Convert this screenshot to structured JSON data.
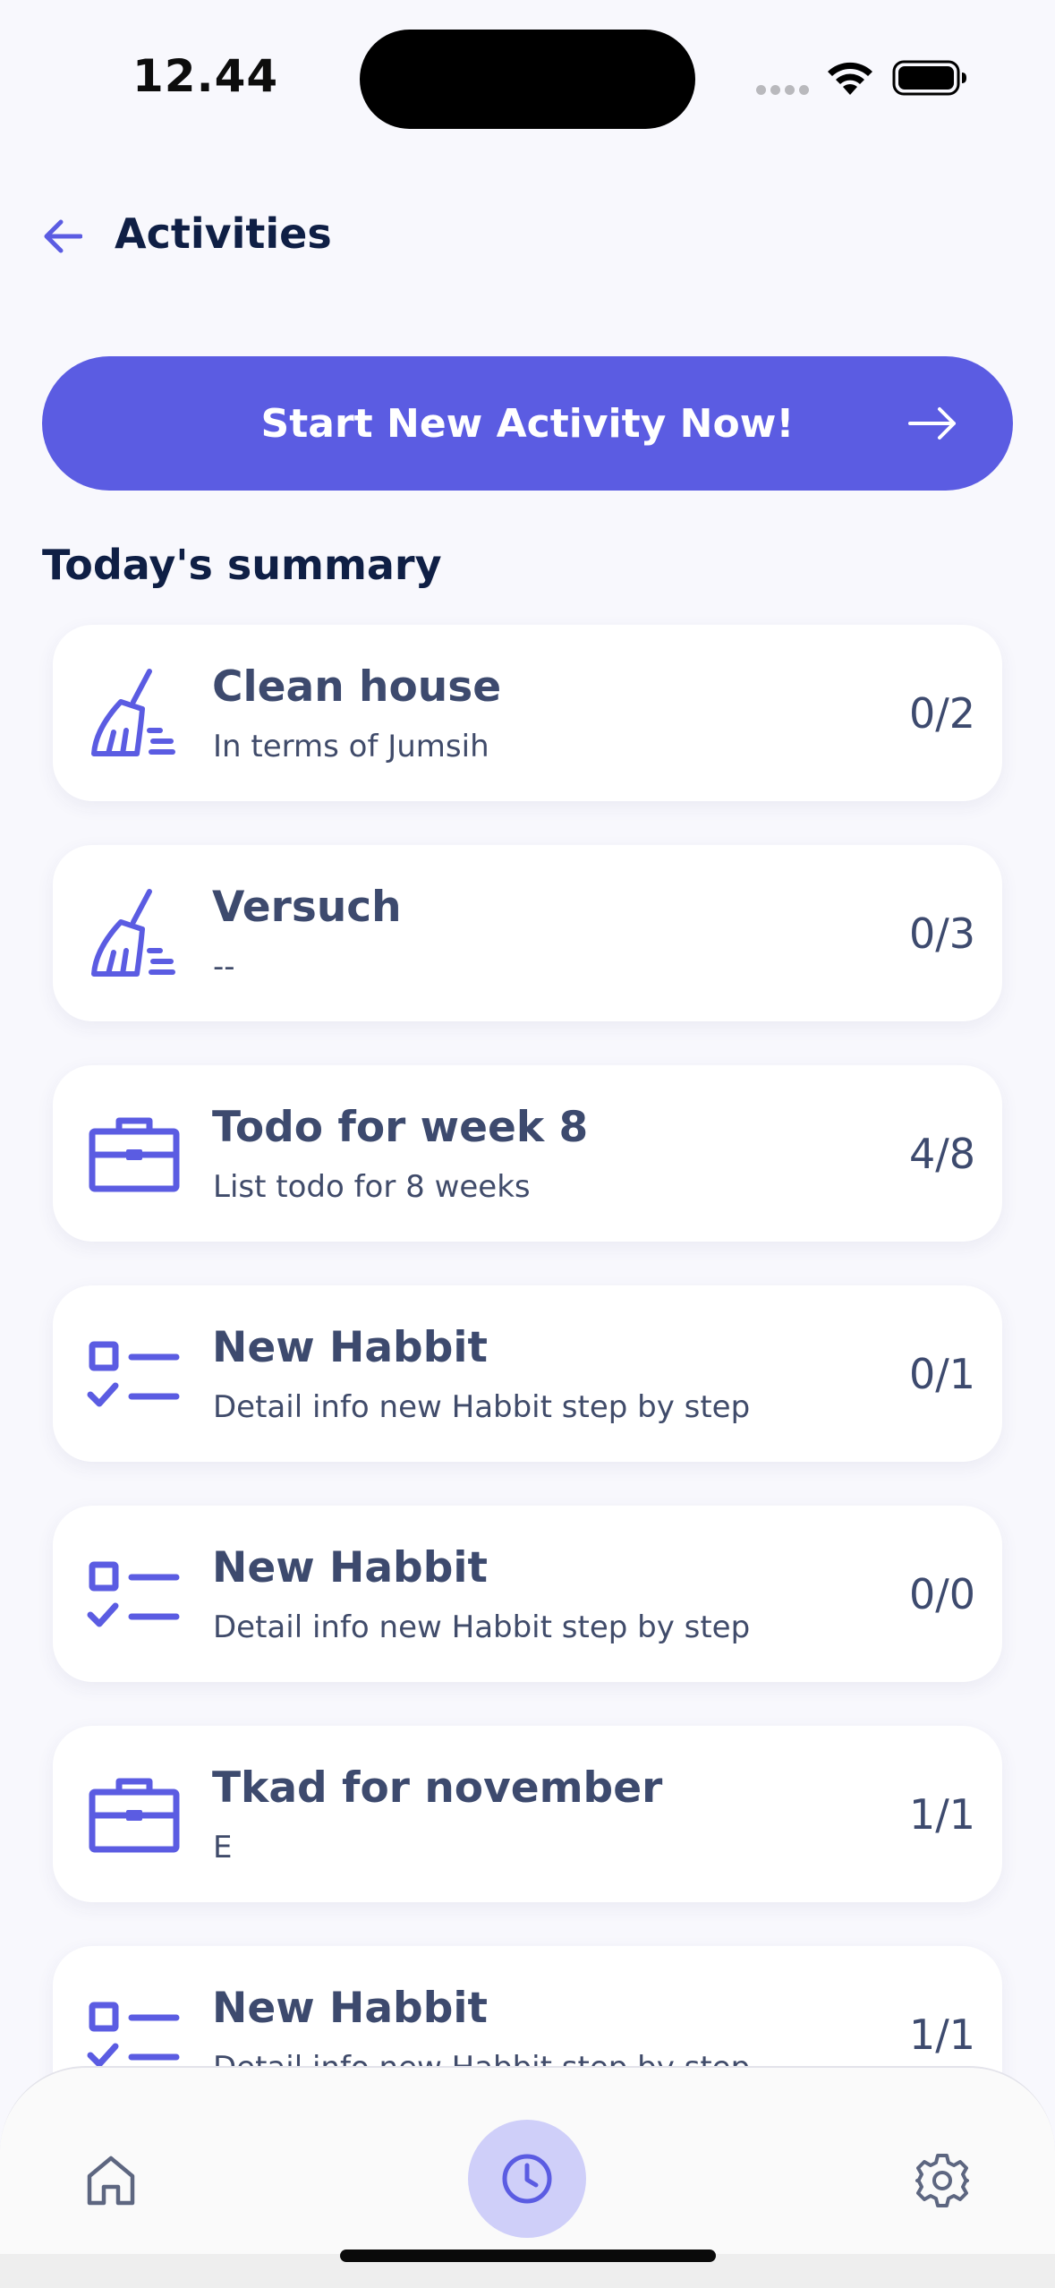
{
  "status_bar": {
    "time": "12.44"
  },
  "header": {
    "title": "Activities",
    "back_icon": "arrow-left-icon"
  },
  "cta": {
    "label": "Start New Activity Now!",
    "icon": "arrow-right-icon"
  },
  "summary": {
    "title": "Today's summary",
    "items": [
      {
        "title": "Clean house",
        "subtitle": "In terms of Jumsih",
        "count": "0/2",
        "icon": "broom-icon"
      },
      {
        "title": "Versuch",
        "subtitle": "--",
        "count": "0/3",
        "icon": "broom-icon"
      },
      {
        "title": "Todo for week 8",
        "subtitle": "List todo for 8 weeks",
        "count": "4/8",
        "icon": "briefcase-icon"
      },
      {
        "title": "New Habbit",
        "subtitle": "Detail info new Habbit step by step",
        "count": "0/1",
        "icon": "checklist-icon"
      },
      {
        "title": "New Habbit",
        "subtitle": "Detail info new Habbit step by step",
        "count": "0/0",
        "icon": "checklist-icon"
      },
      {
        "title": "Tkad for november",
        "subtitle": "E",
        "count": "1/1",
        "icon": "briefcase-icon"
      },
      {
        "title": "New Habbit",
        "subtitle": "Detail info new Habbit step by step",
        "count": "1/1",
        "icon": "checklist-icon"
      }
    ]
  },
  "bottom_nav": {
    "items": [
      {
        "icon": "home-icon",
        "active": false
      },
      {
        "icon": "clock-icon",
        "active": true
      },
      {
        "icon": "gear-icon",
        "active": false
      }
    ]
  },
  "colors": {
    "accent": "#5b5ce2",
    "accent_light": "#cfcff9",
    "text_dark": "#0f1f45",
    "text_card": "#3d4a6e",
    "background": "#f8f8fd"
  }
}
